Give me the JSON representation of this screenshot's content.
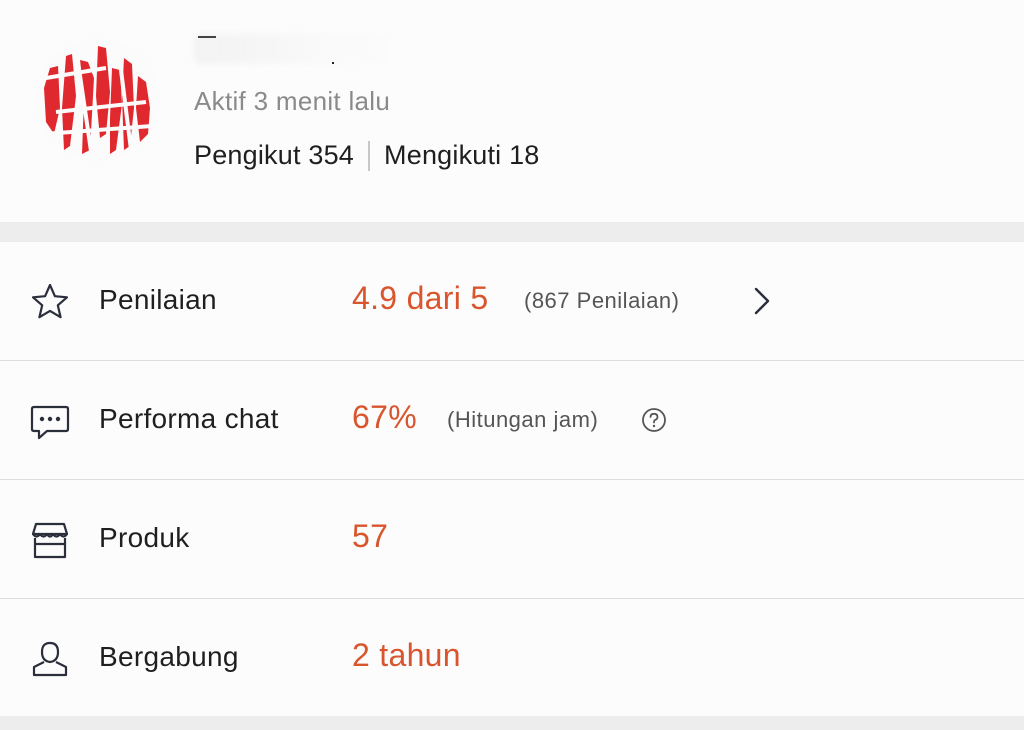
{
  "profile": {
    "active_status": "Aktif 3 menit lalu",
    "followers": "Pengikut 354",
    "following": "Mengikuti 18"
  },
  "stats": {
    "rating": {
      "icon": "star-icon",
      "label": "Penilaian",
      "value": "4.9 dari 5",
      "sub": "(867 Penilaian)"
    },
    "chat": {
      "icon": "chat-bubble-icon",
      "label": "Performa chat",
      "value": "67%",
      "sub": "(Hitungan jam)"
    },
    "products": {
      "icon": "store-icon",
      "label": "Produk",
      "value": "57"
    },
    "joined": {
      "icon": "user-icon",
      "label": "Bergabung",
      "value": "2 tahun"
    }
  },
  "colors": {
    "accent": "#d9552d",
    "text": "#1f1f1f",
    "muted": "#8a8a8a",
    "background": "#ededed",
    "card": "#fcfcfc",
    "avatar_red": "#e0292e"
  }
}
